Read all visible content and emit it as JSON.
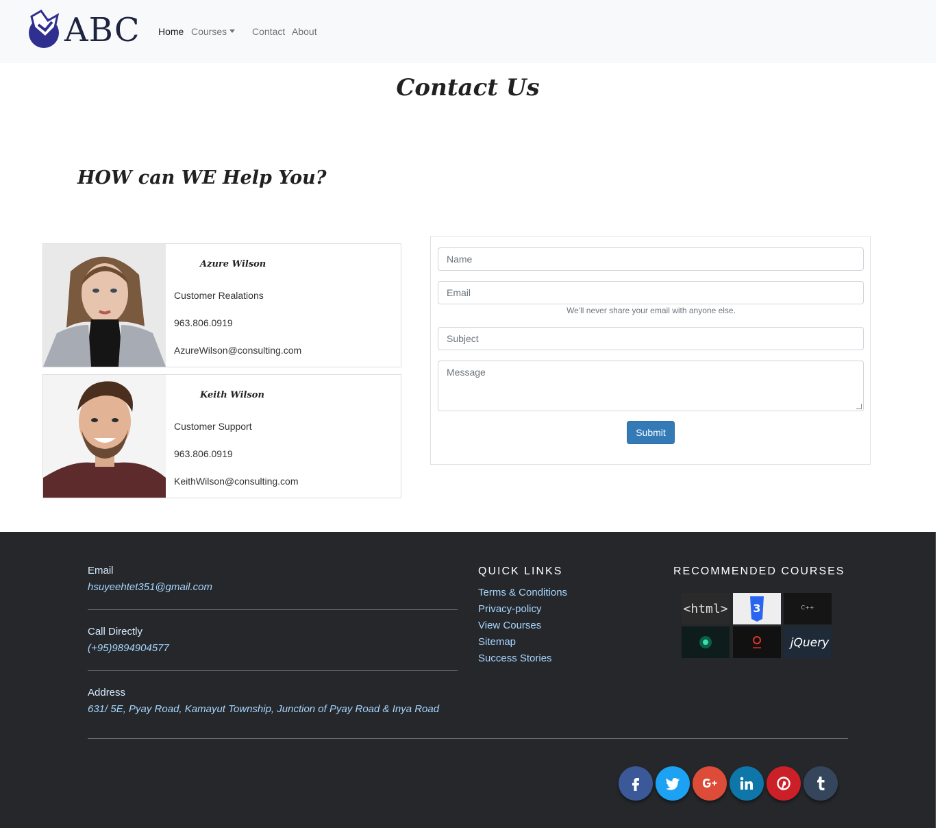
{
  "navbar": {
    "logo_text": "ABC",
    "links": {
      "home": "Home",
      "courses": "Courses",
      "contact": "Contact",
      "about": "About"
    }
  },
  "page_title": "Contact Us",
  "help_title": "HOW can WE Help You?",
  "contacts": [
    {
      "name": "Azure Wilson",
      "role": "Customer Realations",
      "phone": "963.806.0919",
      "email": "AzureWilson@consulting.com"
    },
    {
      "name": "Keith Wilson",
      "role": "Customer Support",
      "phone": "963.806.0919",
      "email": "KeithWilson@consulting.com"
    }
  ],
  "form": {
    "name_placeholder": "Name",
    "email_placeholder": "Email",
    "email_help": "We'll never share your email with anyone else.",
    "subject_placeholder": "Subject",
    "message_placeholder": "Message",
    "submit_label": "Submit"
  },
  "footer": {
    "email_label": "Email",
    "email_value": "hsuyeehtet351@gmail.com",
    "call_label": "Call Directly",
    "call_value": "(+95)9894904577",
    "address_label": "Address",
    "address_value": "631/ 5E, Pyay Road, Kamayut Township, Junction of Pyay Road & Inya Road",
    "quick_links_heading": "QUICK LINKS",
    "quick_links": [
      "Terms & Conditions",
      "Privacy-policy",
      "View Courses",
      "Sitemap",
      "Success Stories"
    ],
    "recommended_heading": "RECOMMENDED COURSES",
    "courses": [
      {
        "label": "<html>",
        "icon": "html-course-thumbnail"
      },
      {
        "label": "CSS 3",
        "icon": "css3-course-thumbnail"
      },
      {
        "label": "C++",
        "icon": "cpp-course-thumbnail"
      },
      {
        "label": "",
        "icon": "green-glow-course-thumbnail"
      },
      {
        "label": "",
        "icon": "red-logo-course-thumbnail"
      },
      {
        "label": "jQuery",
        "icon": "jquery-course-thumbnail"
      }
    ],
    "social": [
      {
        "name": "facebook",
        "color": "#3b5998"
      },
      {
        "name": "twitter",
        "color": "#1da1f2"
      },
      {
        "name": "google-plus",
        "color": "#dd4b39"
      },
      {
        "name": "linkedin",
        "color": "#0e76a8"
      },
      {
        "name": "pinterest",
        "color": "#cb2027"
      },
      {
        "name": "tumblr",
        "color": "#35465c"
      }
    ]
  }
}
